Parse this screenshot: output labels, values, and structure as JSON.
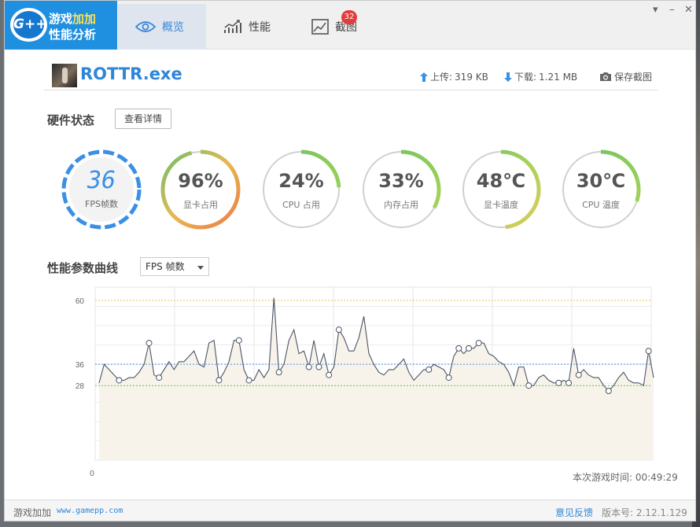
{
  "app": {
    "logo_text": "G++",
    "logo_line1_a": "游戏",
    "logo_line1_b": "加加",
    "logo_line2": "性能分析"
  },
  "tabs": [
    {
      "label": "概览",
      "icon": "eye-icon",
      "active": true
    },
    {
      "label": "性能",
      "icon": "line-chart-icon",
      "active": false
    },
    {
      "label": "截图",
      "icon": "image-icon",
      "active": false,
      "badge": "32"
    }
  ],
  "window_controls": {
    "dropdown": "▾",
    "minimize": "–",
    "close": "✕"
  },
  "game": {
    "name": "ROTTR.exe",
    "upload_label": "上传:",
    "upload_value": "319 KB",
    "download_label": "下载:",
    "download_value": "1.21 MB",
    "screenshot_label": "保存截图"
  },
  "hardware": {
    "title": "硬件状态",
    "details_button": "查看详情"
  },
  "gauges": {
    "fps": {
      "value": "36",
      "label": "FPS帧数"
    },
    "items": [
      {
        "value": "96%",
        "label": "显卡占用",
        "level": 0.96,
        "colors": [
          "#6cbf6c",
          "#e8b950",
          "#ec7a4a"
        ]
      },
      {
        "value": "24%",
        "label": "CPU 占用",
        "level": 0.24,
        "colors": [
          "#6cbf6c",
          "#8ccc5a",
          "#a4d45a"
        ]
      },
      {
        "value": "33%",
        "label": "内存占用",
        "level": 0.33,
        "colors": [
          "#6cbf6c",
          "#8ccc5a",
          "#b2d45a"
        ]
      },
      {
        "value": "48℃",
        "label": "显卡温度",
        "level": 0.48,
        "colors": [
          "#6cbf6c",
          "#a9d15a",
          "#dccc5a"
        ]
      },
      {
        "value": "30℃",
        "label": "CPU 温度",
        "level": 0.3,
        "colors": [
          "#6cbf6c",
          "#8ccc5a",
          "#a8d45a"
        ]
      }
    ]
  },
  "curve": {
    "title": "性能参数曲线",
    "selected": "FPS 帧数"
  },
  "chart_data": {
    "type": "line",
    "title": "",
    "xlabel": "",
    "ylabel": "",
    "x_start_label": "0",
    "ylim": [
      0,
      65
    ],
    "y_ticks": [
      28,
      36,
      60
    ],
    "reference_lines": [
      {
        "value": 60,
        "color": "#f0c24a"
      },
      {
        "value": 36,
        "color": "#4a8fe6"
      },
      {
        "value": 28,
        "color": "#5cbf5c"
      }
    ],
    "values": [
      29,
      36,
      34,
      32,
      30,
      30,
      31,
      31,
      33,
      36,
      44,
      32,
      31,
      34,
      37,
      34,
      37,
      37,
      39,
      41,
      36,
      35,
      44,
      45,
      30,
      33,
      37,
      45,
      45,
      34,
      30,
      30,
      34,
      31,
      34,
      61,
      33,
      36,
      45,
      49,
      40,
      41,
      35,
      45,
      35,
      40,
      32,
      35,
      49,
      46,
      41,
      41,
      46,
      54,
      40,
      36,
      33,
      32,
      34,
      34,
      36,
      38,
      33,
      30,
      32,
      34,
      34,
      36,
      35,
      34,
      31,
      39,
      42,
      40,
      42,
      42,
      44,
      44,
      40,
      39,
      37,
      36,
      33,
      28,
      35,
      35,
      28,
      28,
      31,
      32,
      30,
      29,
      29,
      30,
      29,
      42,
      32,
      34,
      32,
      31,
      31,
      28,
      26,
      28,
      31,
      33,
      30,
      29,
      29,
      28,
      41,
      31
    ]
  },
  "play_time": "本次游戏时间: 00:49:29",
  "footer": {
    "brand": "游戏加加",
    "url": "www.gamepp.com",
    "feedback": "意见反馈",
    "version": "版本号: 2.12.1.129"
  }
}
